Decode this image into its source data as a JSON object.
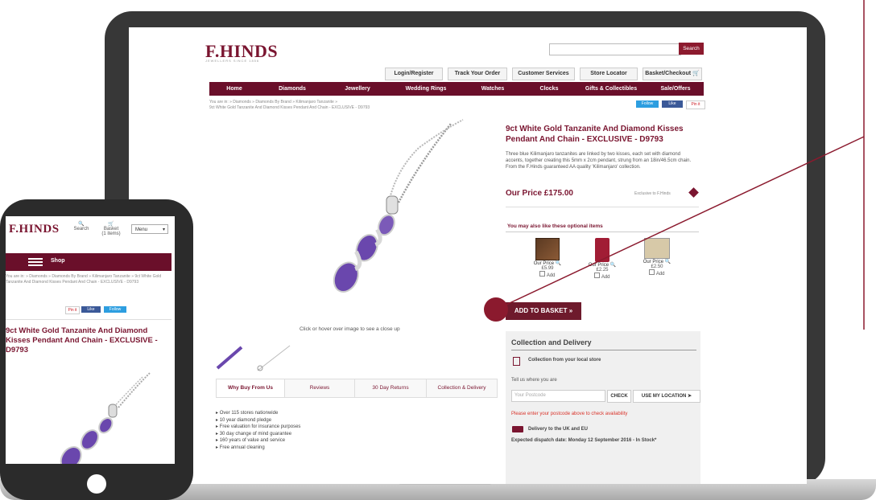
{
  "desktop": {
    "logo": "F.HINDS",
    "tagline": "JEWELLERS SINCE 1856",
    "search_button": "Search",
    "top_buttons": [
      "Login/Register",
      "Track Your Order",
      "Customer Services",
      "Store Locator",
      "Basket/Checkout"
    ],
    "nav": [
      "Home",
      "Diamonds",
      "Jewellery",
      "Wedding Rings",
      "Watches",
      "Clocks",
      "Gifts & Collectibles",
      "Sale/Offers"
    ],
    "breadcrumb_line1": "You are in:  »  Diamonds  »  Diamonds By Brand  »  Kilimanjaro Tanzanite  »",
    "breadcrumb_line2": "9ct White Gold Tanzanite And Diamond Kisses Pendant And Chain - EXCLUSIVE - D9793",
    "social": [
      "Follow",
      "Like",
      "Pin it"
    ],
    "product_title": "9ct White Gold Tanzanite And Diamond Kisses Pendant And Chain - EXCLUSIVE - D9793",
    "description": "Three blue Kilimanjaro tanzanites are linked by two kisses, each set with diamond accents, together creating this 5mm x 2cm pendant, strung from an 18in/46.5cm chain. From the F.Hinds guaranteed AA quality 'Kilimanjaro' collection.",
    "price_label": "Our Price £175.00",
    "exclusive_label": "Exclusive to F.Hinds",
    "optional_heading": "You may also like these optional items",
    "optional_items": [
      {
        "price_label": "Our Price",
        "price": "£5.99",
        "add": "Add"
      },
      {
        "price_label": "Our Price",
        "price": "£2.25",
        "add": "Add"
      },
      {
        "price_label": "Our Price",
        "price": "£2.50",
        "add": "Add"
      }
    ],
    "add_to_basket": "ADD TO BASKET  »",
    "zoom_hint": "Click or hover over image to see a close up",
    "tabs": [
      "Why Buy From Us",
      "Reviews",
      "30 Day Returns",
      "Collection & Delivery"
    ],
    "why_buy": [
      "Over 115 stores nationwide",
      "10 year diamond pledge",
      "Free valuation for insurance purposes",
      "30 day change of mind guarantee",
      "160 years of value and service",
      "Free annual cleaning"
    ],
    "collection": {
      "heading": "Collection and Delivery",
      "local_store": "Collection from your local store",
      "tell_us": "Tell us where you are",
      "postcode_placeholder": "Your Postcode",
      "check": "CHECK",
      "use_location": "USE MY LOCATION",
      "warning": "Please enter your postcode above to check availability",
      "delivery_heading": "Delivery to the UK and EU",
      "dispatch": "Expected dispatch date: Monday 12 September 2016 - In Stock*"
    }
  },
  "mobile": {
    "logo": "F.HINDS",
    "search_label": "Search",
    "basket_label": "Basket",
    "basket_count": "(1 items)",
    "menu_label": "Menu",
    "shop_label": "Shop",
    "breadcrumb": "You are in:  »  Diamonds  »  Diamonds By Brand  »  Kilimanjaro Tanzanite  »  9ct White Gold Tanzanite And Diamond Kisses Pendant And Chain - EXCLUSIVE - D9793",
    "social": [
      "Pin it",
      "Like",
      "Follow"
    ],
    "product_title": "9ct White Gold Tanzanite And Diamond Kisses Pendant And Chain - EXCLUSIVE - D9793"
  },
  "colors": {
    "brand": "#6a0f2a",
    "accent": "#7a1530",
    "callout": "#8b1a2e"
  }
}
